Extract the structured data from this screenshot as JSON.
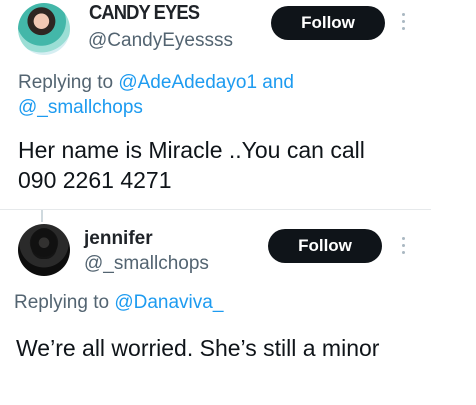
{
  "tweets": [
    {
      "display_name": "CANDY EYES",
      "handle": "@CandyEyessss",
      "follow_label": "Follow",
      "replying_prefix": "Replying to",
      "replying_to": [
        "@AdeAdedayo1",
        "and",
        "@_smallchops"
      ],
      "text_lines": [
        "Her name is Miracle ..You can call",
        "090 2261 4271"
      ]
    },
    {
      "display_name": "jennifer",
      "handle": "@_smallchops",
      "follow_label": "Follow",
      "replying_prefix": "Replying to",
      "replying_to": [
        "@Danaviva_"
      ],
      "text_lines": [
        "We’re all worried. She’s still a minor"
      ]
    }
  ],
  "icons": {
    "more": "more-options-icon"
  },
  "colors": {
    "text": "#0f1419",
    "secondary": "#536471",
    "link": "#1d9bf0",
    "button": "#0f1419"
  }
}
